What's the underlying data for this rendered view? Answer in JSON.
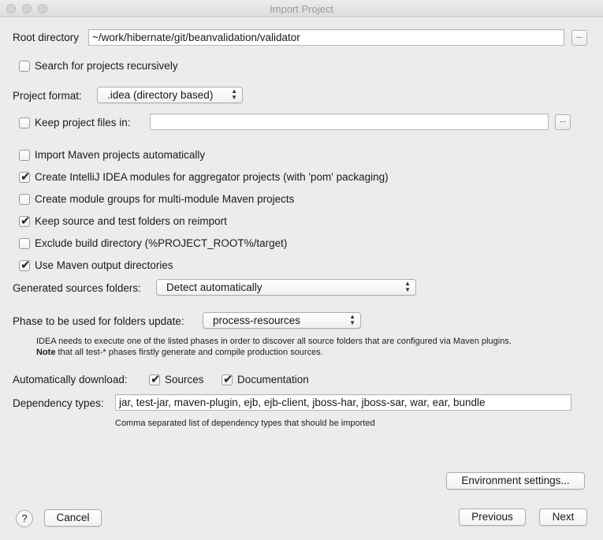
{
  "window": {
    "title": "Import Project"
  },
  "root_directory": {
    "label": "Root directory",
    "value": "~/work/hibernate/git/beanvalidation/validator",
    "browse_label": "..."
  },
  "search_recursively": {
    "label": "Search for projects recursively",
    "checked": false
  },
  "project_format": {
    "label": "Project format:",
    "selected": ".idea (directory based)"
  },
  "keep_project_files": {
    "label": "Keep project files in:",
    "checked": false,
    "value": "",
    "browse_label": "..."
  },
  "maven_options": [
    {
      "label": "Import Maven projects automatically",
      "checked": false
    },
    {
      "label": "Create IntelliJ IDEA modules for aggregator projects (with 'pom' packaging)",
      "checked": true
    },
    {
      "label": "Create module groups for multi-module Maven projects",
      "checked": false
    },
    {
      "label": "Keep source and test folders on reimport",
      "checked": true
    },
    {
      "label": "Exclude build directory (%PROJECT_ROOT%/target)",
      "checked": false
    },
    {
      "label": "Use Maven output directories",
      "checked": true
    }
  ],
  "generated_sources": {
    "label": "Generated sources folders:",
    "selected": "Detect automatically"
  },
  "phase": {
    "label": "Phase to be used for folders update:",
    "selected": "process-resources",
    "hint_line1": "IDEA needs to execute one of the listed phases in order to discover all source folders that are configured via Maven plugins.",
    "hint_note": "Note",
    "hint_line2": " that all test-* phases firstly generate and compile production sources."
  },
  "auto_download": {
    "label": "Automatically download:",
    "sources_label": "Sources",
    "sources_checked": true,
    "documentation_label": "Documentation",
    "documentation_checked": true
  },
  "dependency_types": {
    "label": "Dependency types:",
    "value": "jar, test-jar, maven-plugin, ejb, ejb-client, jboss-har, jboss-sar, war, ear, bundle",
    "hint": "Comma separated list of dependency types that should be imported"
  },
  "buttons": {
    "environment": "Environment settings...",
    "help": "?",
    "cancel": "Cancel",
    "previous": "Previous",
    "next": "Next"
  },
  "glyphs": {
    "tick": "✔",
    "popup_arrows_up": "▲",
    "popup_arrows_down": "▼"
  }
}
